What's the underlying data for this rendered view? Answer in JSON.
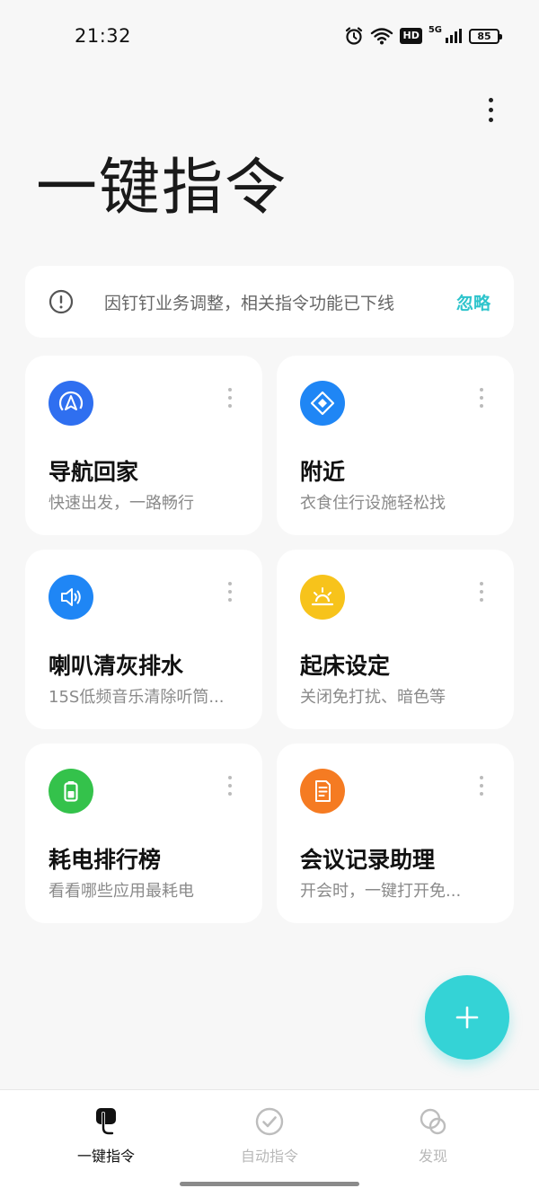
{
  "status_bar": {
    "time": "21:32",
    "network": "5G",
    "hd": "HD",
    "battery": "85",
    "icons": [
      "alarm-icon",
      "wifi-icon",
      "hd-icon",
      "signal-icon",
      "battery-icon"
    ]
  },
  "header": {
    "title": "一键指令",
    "more_icon": "more-vertical-icon"
  },
  "notice": {
    "icon": "info-circle-icon",
    "text": "因钉钉业务调整，相关指令功能已下线",
    "action": "忽略",
    "action_color": "#2ec4cc"
  },
  "cards": [
    {
      "title": "导航回家",
      "subtitle": "快速出发，一路畅行",
      "icon": "navigation-arrow-icon",
      "color": "#2f6ff0"
    },
    {
      "title": "附近",
      "subtitle": "衣食住行设施轻松找",
      "icon": "location-diamond-icon",
      "color": "#1f86f5"
    },
    {
      "title": "喇叭清灰排水",
      "subtitle": "15S低频音乐清除听筒...",
      "icon": "speaker-icon",
      "color": "#1f86f5"
    },
    {
      "title": "起床设定",
      "subtitle": "关闭免打扰、暗色等",
      "icon": "sunrise-icon",
      "color": "#f7c31b"
    },
    {
      "title": "耗电排行榜",
      "subtitle": "看看哪些应用最耗电",
      "icon": "battery-icon",
      "color": "#34c24b"
    },
    {
      "title": "会议记录助理",
      "subtitle": "开会时，一键打开免...",
      "icon": "document-icon",
      "color": "#f57b22"
    }
  ],
  "fab": {
    "icon": "plus-icon",
    "color": "#34d3d6"
  },
  "bottom_nav": [
    {
      "label": "一键指令",
      "icon": "one-tap-command-icon",
      "active": true
    },
    {
      "label": "自动指令",
      "icon": "check-circle-icon",
      "active": false
    },
    {
      "label": "发现",
      "icon": "discover-icon",
      "active": false
    }
  ]
}
